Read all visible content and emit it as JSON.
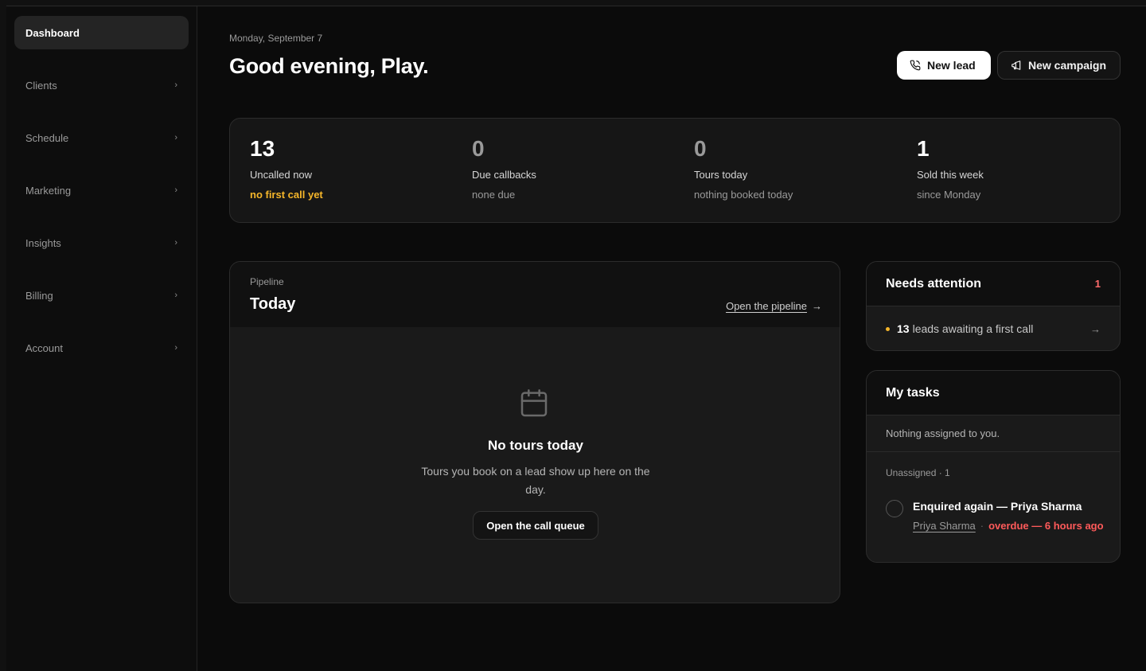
{
  "sidebar": {
    "items": [
      {
        "label": "Dashboard",
        "active": true
      },
      {
        "label": "Clients"
      },
      {
        "label": "Schedule"
      },
      {
        "label": "Marketing"
      },
      {
        "label": "Insights"
      },
      {
        "label": "Billing"
      },
      {
        "label": "Account"
      }
    ]
  },
  "header": {
    "date": "Monday, September 7",
    "greeting": "Good evening, Play.",
    "new_lead": "New lead",
    "new_campaign": "New campaign"
  },
  "stats": [
    {
      "value": "13",
      "label": "Uncalled now",
      "sub": "no first call yet"
    },
    {
      "value": "0",
      "label": "Due callbacks",
      "sub": "none due"
    },
    {
      "value": "0",
      "label": "Tours today",
      "sub": "nothing booked today"
    },
    {
      "value": "1",
      "label": "Sold this week",
      "sub": "since Monday"
    }
  ],
  "pipeline": {
    "kicker": "Pipeline",
    "title": "Today",
    "link": "Open the pipeline",
    "empty_title": "No tours today",
    "empty_desc": "Tours you book on a lead show up here on the day.",
    "empty_button": "Open the call queue"
  },
  "attention": {
    "title": "Needs attention",
    "count": "1",
    "row_count": "13",
    "row_text": "leads awaiting a first call",
    "arrow": "→"
  },
  "tasks": {
    "title": "My tasks",
    "empty": "Nothing assigned to you.",
    "unassigned": "Unassigned · 1",
    "item_title": "Enquired again — Priya Sharma",
    "item_person": "Priya Sharma",
    "item_sep": "·",
    "item_overdue": "overdue — 6 hours ago"
  },
  "colors": {
    "accent_warn": "#f5b62a",
    "accent_danger": "#ff5a5a",
    "background": "#0b0b0b",
    "card": "#1a1a1a"
  }
}
